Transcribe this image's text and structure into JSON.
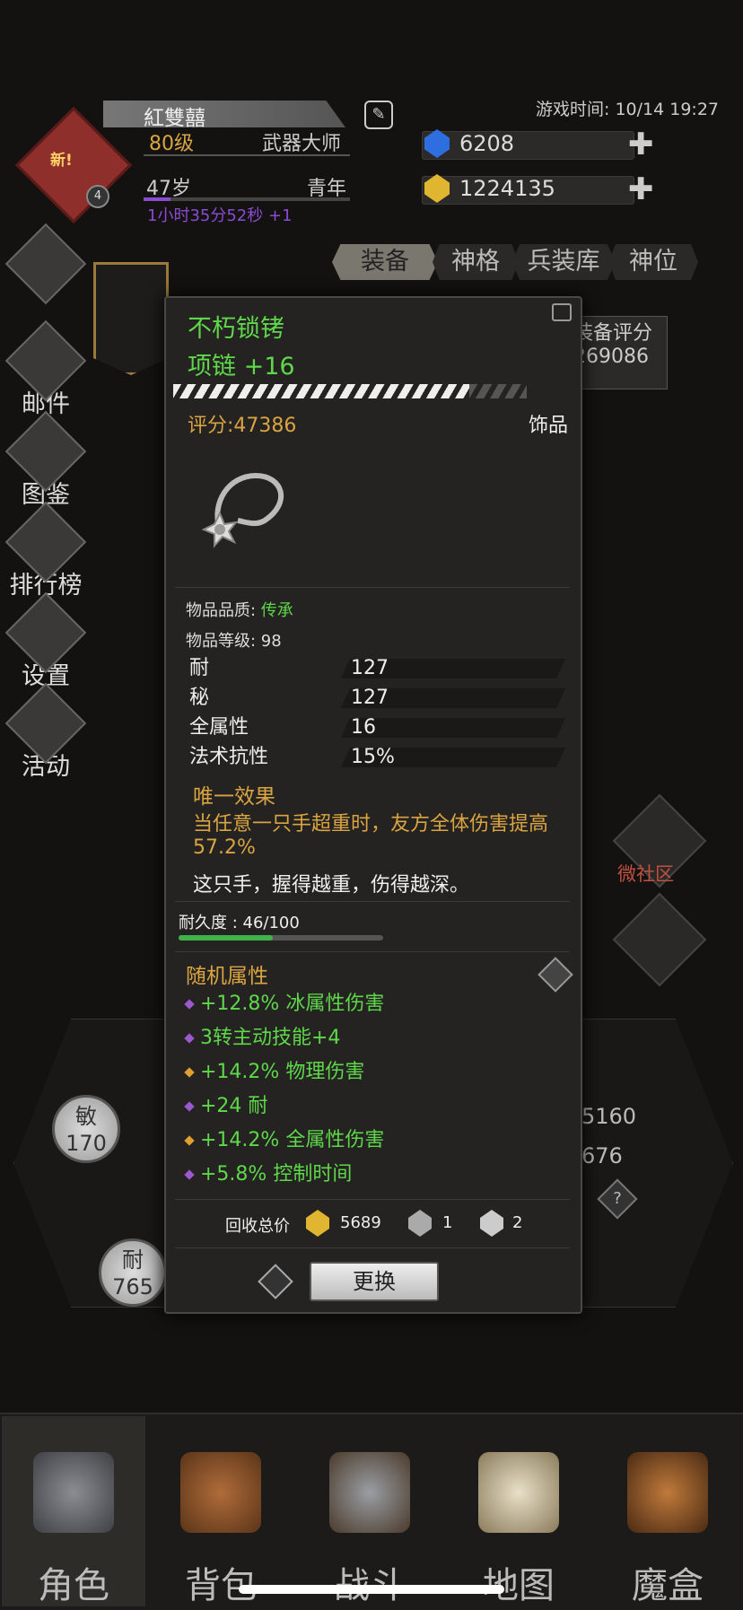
{
  "status": {
    "game_time": "游戏时间: 10/14 19:27"
  },
  "character": {
    "new_badge": "新!",
    "avatar_level": "4",
    "name": "紅雙囍",
    "level": "80级",
    "class": "武器大师",
    "age": "47岁",
    "life_stage": "青年",
    "age_timer": "1小时35分52秒 +1"
  },
  "currency": {
    "gems": "6208",
    "gold": "1224135"
  },
  "tabs": [
    "装备",
    "神格",
    "兵装库",
    "神位"
  ],
  "sidebar": [
    {
      "label": "",
      "icon": "diamond-icon"
    },
    {
      "label": "邮件",
      "icon": "mail-icon"
    },
    {
      "label": "图鉴",
      "icon": "book-icon"
    },
    {
      "label": "排行榜",
      "icon": "ranking-icon"
    },
    {
      "label": "设置",
      "icon": "gear-icon"
    },
    {
      "label": "活动",
      "icon": "event-icon"
    }
  ],
  "equip_score": {
    "label": "装备评分",
    "value": "269086"
  },
  "right": {
    "community": "微社区"
  },
  "stats_bg": {
    "agi_label": "敏",
    "agi": "170",
    "sta_label": "耐",
    "sta": "765",
    "num1": "5160",
    "num2": "676"
  },
  "item": {
    "name": "不朽锁铐",
    "type_line": "项链 +16",
    "score": "评分:47386",
    "category": "饰品",
    "quality_label": "物品品质: ",
    "quality": "传承",
    "level": "物品等级: 98",
    "attributes": [
      {
        "k": "耐",
        "v": "127"
      },
      {
        "k": "秘",
        "v": "127"
      },
      {
        "k": "全属性",
        "v": "16"
      },
      {
        "k": "法术抗性",
        "v": "15%"
      }
    ],
    "unique_title": "唯一效果",
    "unique_desc": "当任意一只手超重时，友方全体伤害提高 57.2%",
    "flavor": "这只手，握得越重，伤得越深。",
    "durability": "耐久度 : 46/100",
    "durability_ratio": 0.46,
    "random_title": "随机属性",
    "random_attrs": [
      {
        "text": "+12.8% 冰属性伤害",
        "dot": "#9b59d0"
      },
      {
        "text": "3转主动技能+4",
        "dot": "#9b59d0"
      },
      {
        "text": "+14.2% 物理伤害",
        "dot": "#e0a030"
      },
      {
        "text": "+24 耐",
        "dot": "#9b59d0"
      },
      {
        "text": "+14.2% 全属性伤害",
        "dot": "#e0a030"
      },
      {
        "text": "+5.8% 控制时间",
        "dot": "#9b59d0"
      }
    ],
    "recycle_label": "回收总价",
    "recycle_gold": "5689",
    "recycle_a": "1",
    "recycle_b": "2",
    "replace_label": "更换"
  },
  "nav": [
    {
      "label": "角色",
      "icon": "helmet-icon"
    },
    {
      "label": "背包",
      "icon": "backpack-icon"
    },
    {
      "label": "战斗",
      "icon": "sword-shield-icon"
    },
    {
      "label": "地图",
      "icon": "scroll-map-icon"
    },
    {
      "label": "魔盒",
      "icon": "magic-box-icon"
    }
  ]
}
